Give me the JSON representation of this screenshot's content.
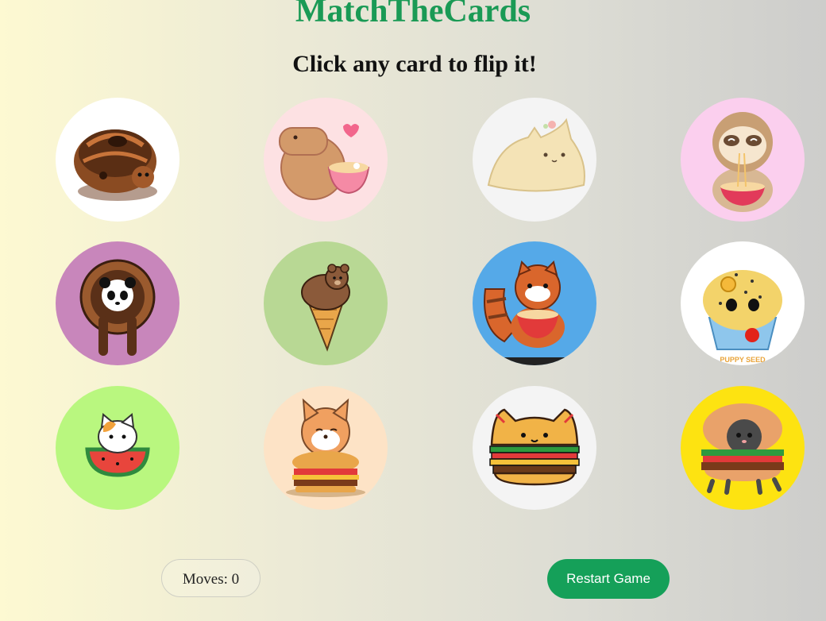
{
  "game": {
    "title": "MatchTheCards",
    "instruction": "Click any card to flip it!"
  },
  "cards": [
    {
      "icon": "chocolate-donut-turtle-icon",
      "bg": "#ffffff"
    },
    {
      "icon": "capybara-ramen-icon",
      "bg": "#fde1e3"
    },
    {
      "icon": "cream-cat-bun-icon",
      "bg": "#f4f4f4"
    },
    {
      "icon": "sloth-ramen-icon",
      "bg": "#fbcfee"
    },
    {
      "icon": "panda-donut-icon",
      "bg": "#c886bb"
    },
    {
      "icon": "bear-icecream-cone-icon",
      "bg": "#b8d894"
    },
    {
      "icon": "red-panda-ramen-icon",
      "bg": "#55a9e8"
    },
    {
      "icon": "puppy-seed-muffin-icon",
      "bg": "#ffffff"
    },
    {
      "icon": "cat-watermelon-icon",
      "bg": "#b9f77f"
    },
    {
      "icon": "fox-burger-icon",
      "bg": "#fde3c6"
    },
    {
      "icon": "cat-burger-icon",
      "bg": "#f4f4f4"
    },
    {
      "icon": "cat-in-burger-icon",
      "bg": "#fde311"
    }
  ],
  "card_texts": {
    "puppy_seed": "PUPPY SEED"
  },
  "status": {
    "moves_label": "Moves: 0"
  },
  "controls": {
    "restart_label": "Restart Game"
  },
  "colors": {
    "accent": "#15a059",
    "title": "#1a9a55"
  }
}
